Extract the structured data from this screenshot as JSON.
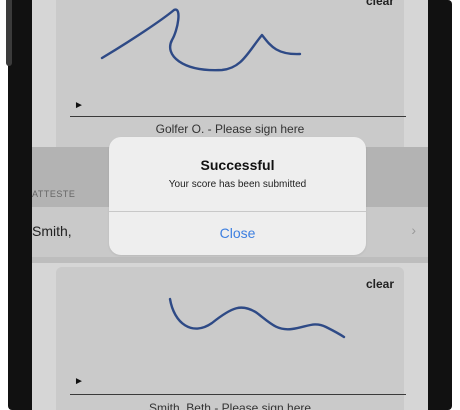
{
  "golfer_signature": {
    "clear_label": "clear",
    "marker": "►",
    "caption": "Golfer O. - Please sign here"
  },
  "attester_section": {
    "header": "ATTESTE",
    "attester_name": "Smith,",
    "chevron": "›"
  },
  "attester_signature": {
    "clear_label": "clear",
    "marker": "►",
    "caption": "Smith, Beth - Please sign here"
  },
  "alert": {
    "title": "Successful",
    "message": "Your score has been submitted",
    "close_label": "Close"
  },
  "colors": {
    "ink": "#2e4a86",
    "link": "#3d7fe0"
  }
}
